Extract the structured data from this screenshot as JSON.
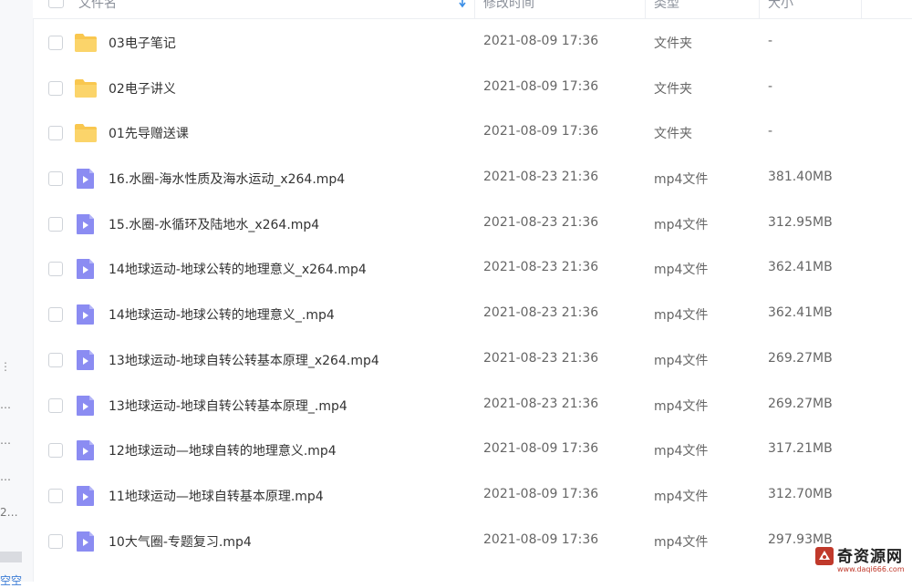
{
  "sidebar": {
    "marks": [
      "⋮",
      "…",
      "…",
      "…",
      "2…"
    ],
    "bottom_text": "空空"
  },
  "header": {
    "name_label": "文件名",
    "date_label": "修改时间",
    "type_label": "类型",
    "size_label": "大小"
  },
  "files": [
    {
      "kind": "folder",
      "name": "03电子笔记",
      "date": "2021-08-09 17:36",
      "type": "文件夹",
      "size": "-"
    },
    {
      "kind": "folder",
      "name": "02电子讲义",
      "date": "2021-08-09 17:36",
      "type": "文件夹",
      "size": "-"
    },
    {
      "kind": "folder",
      "name": "01先导赠送课",
      "date": "2021-08-09 17:36",
      "type": "文件夹",
      "size": "-"
    },
    {
      "kind": "video",
      "name": "16.水圈-海水性质及海水运动_x264.mp4",
      "date": "2021-08-23 21:36",
      "type": "mp4文件",
      "size": "381.40MB"
    },
    {
      "kind": "video",
      "name": "15.水圈-水循环及陆地水_x264.mp4",
      "date": "2021-08-23 21:36",
      "type": "mp4文件",
      "size": "312.95MB"
    },
    {
      "kind": "video",
      "name": "14地球运动-地球公转的地理意义_x264.mp4",
      "date": "2021-08-23 21:36",
      "type": "mp4文件",
      "size": "362.41MB"
    },
    {
      "kind": "video",
      "name": "14地球运动-地球公转的地理意义_.mp4",
      "date": "2021-08-23 21:36",
      "type": "mp4文件",
      "size": "362.41MB"
    },
    {
      "kind": "video",
      "name": "13地球运动-地球自转公转基本原理_x264.mp4",
      "date": "2021-08-23 21:36",
      "type": "mp4文件",
      "size": "269.27MB"
    },
    {
      "kind": "video",
      "name": "13地球运动-地球自转公转基本原理_.mp4",
      "date": "2021-08-23 21:36",
      "type": "mp4文件",
      "size": "269.27MB"
    },
    {
      "kind": "video",
      "name": "12地球运动—地球自转的地理意义.mp4",
      "date": "2021-08-09 17:36",
      "type": "mp4文件",
      "size": "317.21MB"
    },
    {
      "kind": "video",
      "name": "11地球运动—地球自转基本原理.mp4",
      "date": "2021-08-09 17:36",
      "type": "mp4文件",
      "size": "312.70MB"
    },
    {
      "kind": "video",
      "name": "10大气圈-专题复习.mp4",
      "date": "2021-08-09 17:36",
      "type": "mp4文件",
      "size": "297.93MB"
    }
  ],
  "watermark": {
    "text": "奇资源网",
    "url": "www.daqi666.com"
  },
  "colors": {
    "folder": "#f9c74f",
    "video": "#8b8cf2",
    "sort_arrow": "#3a8ee6"
  },
  "icons": {
    "folder": "folder-icon",
    "video": "video-file-icon",
    "sort": "sort-arrow-down-icon"
  }
}
